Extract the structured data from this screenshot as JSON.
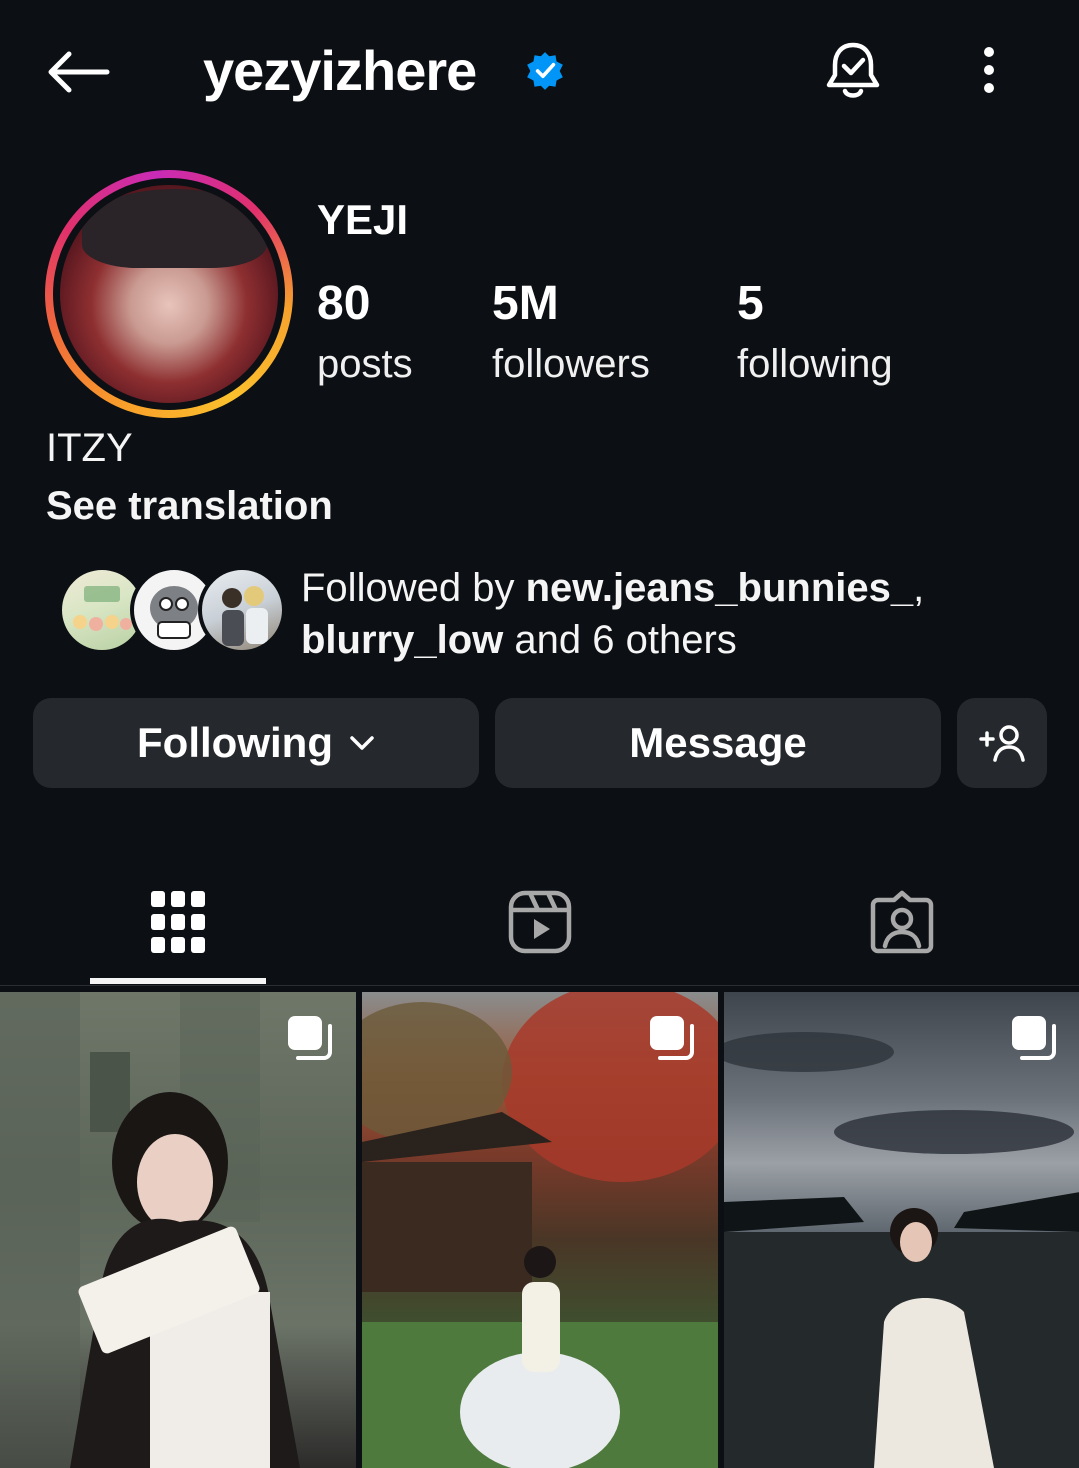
{
  "header": {
    "username": "yezyizhere",
    "verified": true
  },
  "profile": {
    "display_name": "YEJI",
    "stats": {
      "posts": {
        "value": "80",
        "label": "posts"
      },
      "followers": {
        "value": "5M",
        "label": "followers"
      },
      "following": {
        "value": "5",
        "label": "following"
      }
    },
    "bio": "ITZY",
    "see_translation": "See translation"
  },
  "followed_by": {
    "prefix": "Followed by ",
    "user1": "new.jeans_bunnies_",
    "separator": ",",
    "user2": "blurry_low",
    "middle": " and ",
    "others": "6 others"
  },
  "actions": {
    "following_label": "Following",
    "message_label": "Message"
  },
  "tabs": [
    "posts-grid",
    "reels",
    "tagged"
  ],
  "colors": {
    "background": "#0c1014",
    "button": "#25292e",
    "verified": "#0095f6",
    "text": "#f5f5f5"
  },
  "grid": [
    {
      "type": "carousel",
      "icon": "multi-post-icon"
    },
    {
      "type": "carousel",
      "icon": "multi-post-icon"
    },
    {
      "type": "carousel",
      "icon": "multi-post-icon"
    }
  ]
}
